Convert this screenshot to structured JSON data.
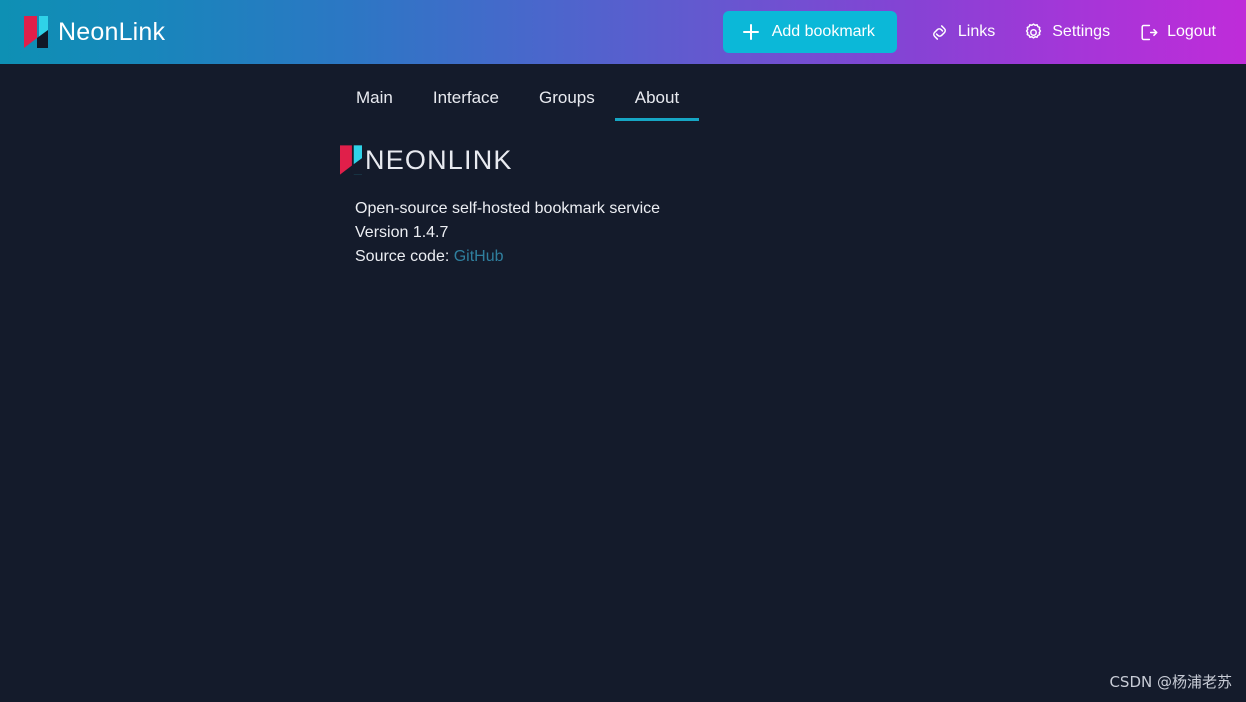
{
  "header": {
    "brand_name": "NeonLink",
    "brand_logo_icon": "neonlink-logo-icon",
    "add_bookmark_label": "Add bookmark",
    "add_bookmark_icon": "plus-icon",
    "links_label": "Links",
    "links_icon": "chain-link-icon",
    "settings_label": "Settings",
    "settings_icon": "gear-icon",
    "logout_label": "Logout",
    "logout_icon": "logout-door-arrow-icon",
    "gradient_from": "#0e90b4",
    "gradient_mid": "#5b5fce",
    "gradient_to": "#bf2cd9",
    "accent_button_color": "#0bb8d8"
  },
  "tabs": [
    {
      "label": "Main",
      "active": false
    },
    {
      "label": "Interface",
      "active": false
    },
    {
      "label": "Groups",
      "active": false
    },
    {
      "label": "About",
      "active": true
    }
  ],
  "about": {
    "wordmark": "NEONLINK",
    "logo_icon": "neonlink-logo-icon",
    "description": "Open-source self-hosted bookmark service",
    "version": "Version 1.4.7",
    "source_prefix": "Source code:",
    "source_link_label": "GitHub",
    "link_color": "#2f7f9e"
  },
  "page": {
    "background_color": "#141b2b",
    "active_tab_underline_color": "#16a6c4",
    "logo_red": "#e01f4a",
    "logo_cyan": "#2fd2e8"
  },
  "watermark": {
    "text": "CSDN @杨浦老苏"
  }
}
